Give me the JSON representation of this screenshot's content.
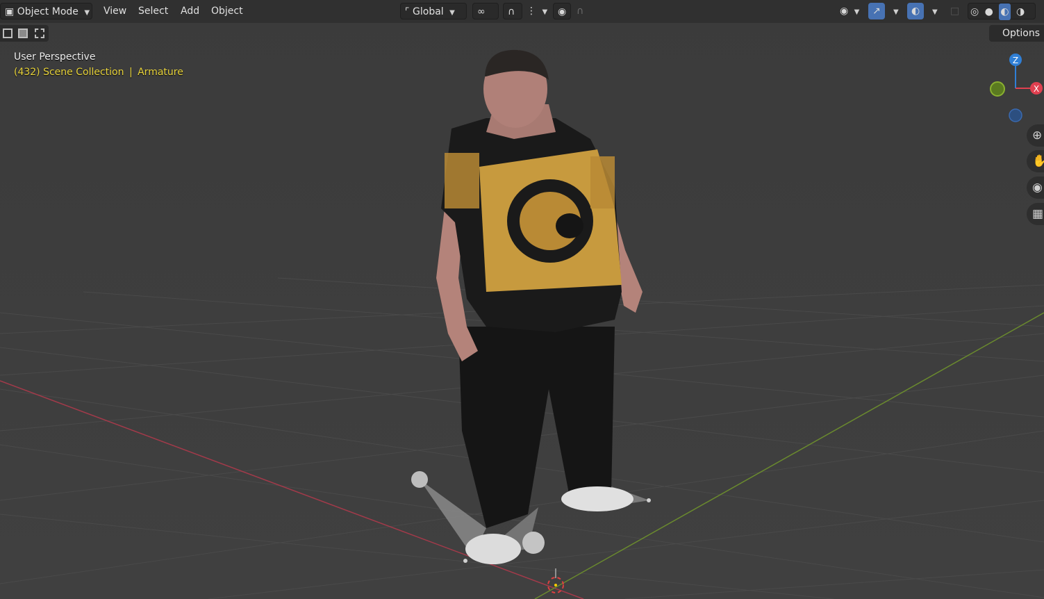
{
  "header": {
    "mode_label": "Object Mode",
    "menus": [
      "View",
      "Select",
      "Add",
      "Object"
    ],
    "orientation_label": "Global"
  },
  "toolbar": {
    "options_label": "Options"
  },
  "overlay": {
    "view_name": "User Perspective",
    "collection": "(432) Scene Collection",
    "separator": "|",
    "active_object": "Armature"
  },
  "gizmo": {
    "z_label": "Z",
    "x_label": "X"
  },
  "icons": {
    "mode": "object-mode-icon",
    "transform_orientation": "transform-axes-icon",
    "pivot": "pivot-icon",
    "snap": "snap-magnet-icon",
    "snap_grid": "snap-grid-icon",
    "proportional": "proportional-edit-icon",
    "falloff": "falloff-curve-icon",
    "visibility": "eye-icon",
    "gizmo_toggle": "gizmo-icon",
    "overlay_toggle": "overlay-icon",
    "xray": "xray-icon",
    "shading_wire": "wireframe-shading-icon",
    "shading_solid": "solid-shading-icon",
    "shading_material": "material-shading-icon",
    "shading_render": "rendered-shading-icon",
    "zoom": "zoom-icon",
    "pan": "hand-pan-icon",
    "camera": "camera-icon",
    "ortho": "grid-perspective-icon"
  },
  "colors": {
    "header_bg": "#303030",
    "viewport_bg": "#3d3d3d",
    "active_button": "#4772b3",
    "collection_text": "#e8d33a",
    "x_axis": "#a33a4a",
    "y_axis": "#6a8a2e",
    "gizmo_z": "#2f7fd6",
    "gizmo_x": "#e04050",
    "gizmo_y": "#6a9a2a"
  }
}
